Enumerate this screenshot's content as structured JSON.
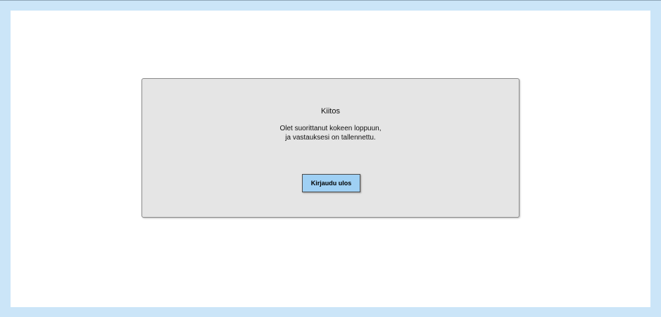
{
  "colors": {
    "background": "#cbe5f8",
    "page": "#ffffff",
    "dialog": "#e5e5e5",
    "button": "#9fd0f4"
  },
  "dialog": {
    "title": "Kiitos",
    "message_line1": "Olet suorittanut kokeen loppuun,",
    "message_line2": "ja vastauksesi on tallennettu.",
    "logout_label": "Kirjaudu ulos"
  }
}
